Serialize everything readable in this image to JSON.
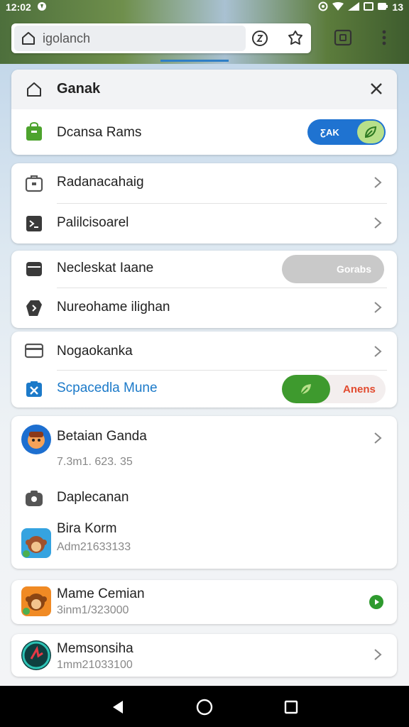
{
  "status": {
    "time": "12:02",
    "battery": "13"
  },
  "browser": {
    "url_text": "igolanch"
  },
  "panel": {
    "title": "Ganak",
    "top_row": {
      "label": "Dcansa Rams",
      "toggle_text": "ƸAK"
    }
  },
  "group1": [
    {
      "label": "Radanacahaig"
    },
    {
      "label": "Palilcisoarel"
    }
  ],
  "group2": {
    "row1": {
      "label": "Necleskat Iaane",
      "button": "Gorabs"
    },
    "row2": {
      "label": "Nureohame ilighan"
    }
  },
  "group3": {
    "row1": {
      "label": "Nogaokanka"
    },
    "row2": {
      "label": "Scpacedla Mune",
      "toggle_text": "Anens"
    }
  },
  "apps_card": [
    {
      "title": "Betaian Ganda",
      "subtitle": "7.3m1. 623. 35"
    },
    {
      "title": "Daplecanan",
      "subtitle": ""
    },
    {
      "title": "Bira Korm",
      "subtitle": "Adm21633133"
    }
  ],
  "app_mame": {
    "title": "Mame Cemian",
    "subtitle": "3inm1/323000"
  },
  "app_memson": {
    "title": "Memsonsiha",
    "subtitle": "1mm21033100"
  },
  "colors": {
    "accent_blue": "#1f73d1",
    "toggle_green": "#3e9a2e",
    "link_blue": "#1c7ac9",
    "warning_red": "#e24a2e"
  }
}
